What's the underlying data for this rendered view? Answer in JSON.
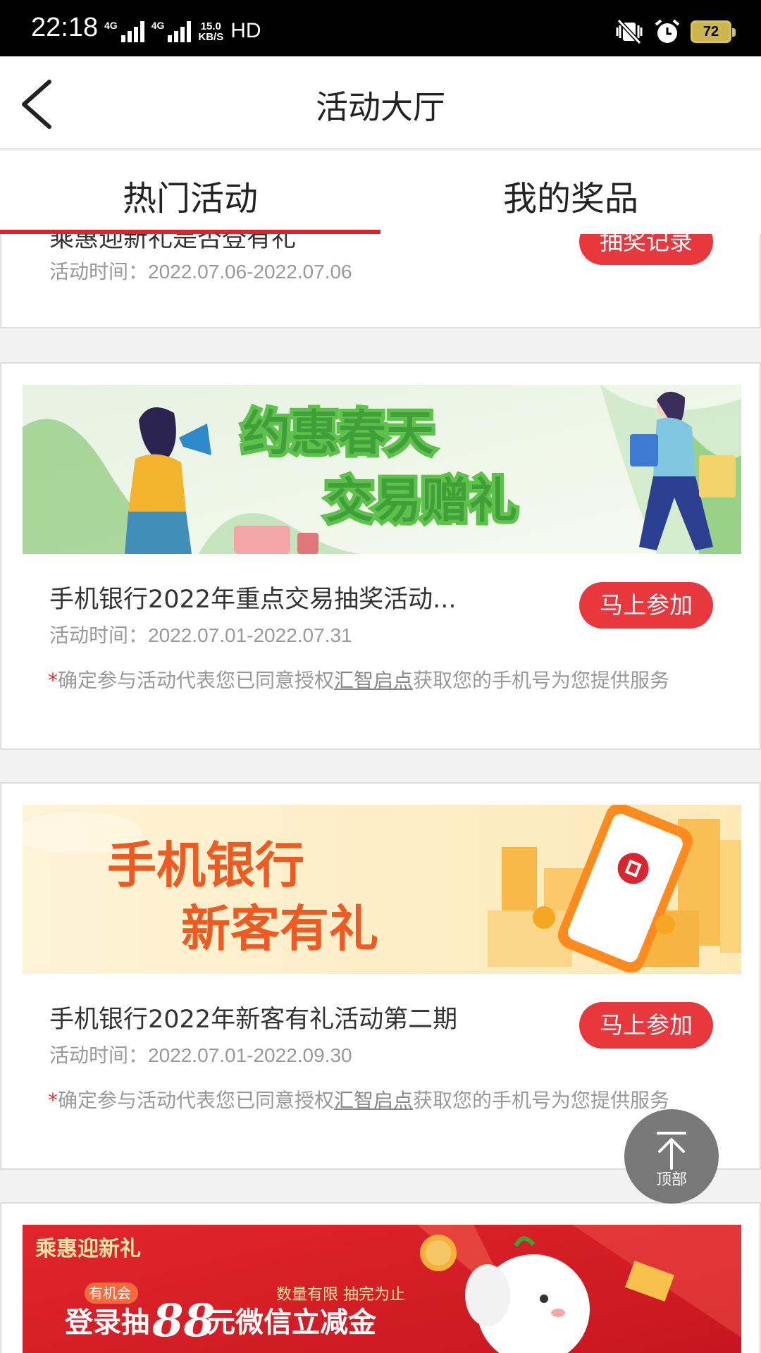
{
  "status_bar": {
    "time": "22:18",
    "net_type_1": "4G",
    "net_type_2": "4G",
    "speed_value": "15.0",
    "speed_unit": "KB/S",
    "hd": "HD",
    "battery": "72"
  },
  "header": {
    "title": "活动大厅",
    "back_icon": "chevron-left-icon"
  },
  "tabs": [
    {
      "label": "热门活动",
      "active": true
    },
    {
      "label": "我的奖品",
      "active": false
    }
  ],
  "activities": [
    {
      "title": "乘惠迎新礼是否登有礼",
      "time_label": "活动时间：",
      "time_value": "2022.07.06-2022.07.06",
      "button": "抽奖记录"
    },
    {
      "banner_line1": "约惠春天",
      "banner_line2": "交易赠礼",
      "title": "手机银行2022年重点交易抽奖活动...",
      "time_label": "活动时间：",
      "time_value": "2022.07.01-2022.07.31",
      "button": "马上参加",
      "notice_star": "*",
      "notice_pre": "确定参与活动代表您已同意授权",
      "notice_link": "汇智启点",
      "notice_post": "获取您的手机号为您提供服务"
    },
    {
      "banner_line1": "手机银行",
      "banner_line2": "新客有礼",
      "title": "手机银行2022年新客有礼活动第二期",
      "time_label": "活动时间：",
      "time_value": "2022.07.01-2022.09.30",
      "button": "马上参加",
      "notice_star": "*",
      "notice_pre": "确定参与活动代表您已同意授权",
      "notice_link": "汇智启点",
      "notice_post": "获取您的手机号为您提供服务"
    },
    {
      "banner_brand": "乘惠迎新礼",
      "banner_chance": "有机会",
      "banner_limited": "数量有限 抽完为止",
      "banner_main_pre": "登录抽",
      "banner_main_num": "88",
      "banner_main_post": "元微信立减金"
    }
  ],
  "back_to_top": {
    "label": "顶部",
    "icon": "arrow-up-icon"
  },
  "colors": {
    "accent": "#e8373d",
    "tab_indicator": "#d9252e"
  }
}
